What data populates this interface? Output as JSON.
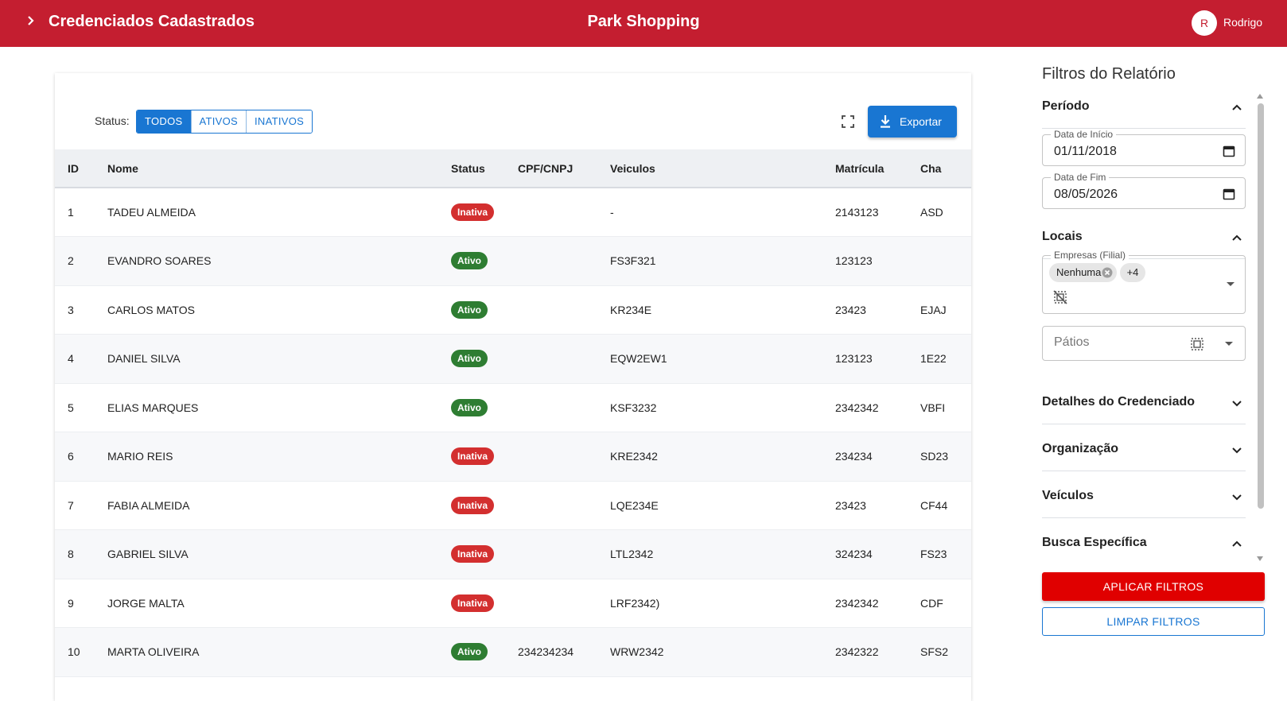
{
  "header": {
    "title": "Credenciados Cadastrados",
    "center_title": "Park Shopping",
    "avatar_initial": "R",
    "user_name": "Rodrigo"
  },
  "toolbar": {
    "status_label": "Status:",
    "toggles": [
      "TODOS",
      "ATIVOS",
      "INATIVOS"
    ],
    "selected_toggle": "TODOS",
    "export_label": "Exportar"
  },
  "table": {
    "columns": [
      "ID",
      "Nome",
      "Status",
      "CPF/CNPJ",
      "Veiculos",
      "Matrícula",
      "Cha"
    ],
    "rows": [
      {
        "id": "1",
        "nome": "TADEU ALMEIDA",
        "status": "Inativa",
        "cpf": "",
        "veiculos": "-",
        "matricula": "2143123",
        "chave": "ASD"
      },
      {
        "id": "2",
        "nome": "EVANDRO SOARES",
        "status": "Ativo",
        "cpf": "",
        "veiculos": "FS3F321",
        "matricula": "123123",
        "chave": ""
      },
      {
        "id": "3",
        "nome": "CARLOS MATOS",
        "status": "Ativo",
        "cpf": "",
        "veiculos": "KR234E",
        "matricula": "23423",
        "chave": "EJAJ"
      },
      {
        "id": "4",
        "nome": "DANIEL SILVA",
        "status": "Ativo",
        "cpf": "",
        "veiculos": "EQW2EW1",
        "matricula": "123123",
        "chave": "1E22"
      },
      {
        "id": "5",
        "nome": "ELIAS MARQUES",
        "status": "Ativo",
        "cpf": "",
        "veiculos": "KSF3232",
        "matricula": "2342342",
        "chave": "VBFI"
      },
      {
        "id": "6",
        "nome": "MARIO REIS",
        "status": "Inativa",
        "cpf": "",
        "veiculos": "KRE2342",
        "matricula": "234234",
        "chave": "SD23"
      },
      {
        "id": "7",
        "nome": "FABIA ALMEIDA",
        "status": "Inativa",
        "cpf": "",
        "veiculos": "LQE234E",
        "matricula": "23423",
        "chave": "CF44"
      },
      {
        "id": "8",
        "nome": "GABRIEL SILVA",
        "status": "Inativa",
        "cpf": "",
        "veiculos": "LTL2342",
        "matricula": "324234",
        "chave": "FS23"
      },
      {
        "id": "9",
        "nome": "JORGE MALTA",
        "status": "Inativa",
        "cpf": "",
        "veiculos": "LRF2342)",
        "matricula": "2342342",
        "chave": "CDF"
      },
      {
        "id": "10",
        "nome": "MARTA OLIVEIRA",
        "status": "Ativo",
        "cpf": "234234234",
        "veiculos": "WRW2342",
        "matricula": "2342322",
        "chave": "SFS2"
      }
    ]
  },
  "filters": {
    "title": "Filtros do Relatório",
    "periodo": {
      "label": "Período",
      "start_label": "Data de Início",
      "start_value": "01/11/2018",
      "end_label": "Data de Fim",
      "end_value": "08/05/2026"
    },
    "locais": {
      "label": "Locais",
      "empresas_label": "Empresas (Filial)",
      "chip": "Nenhuma",
      "more_chip": "+4",
      "patios_placeholder": "Pátios"
    },
    "sections": [
      "Detalhes do Credenciado",
      "Organização",
      "Veículos",
      "Busca Específica"
    ],
    "apply_label": "APLICAR FILTROS",
    "clear_label": "LIMPAR FILTROS"
  },
  "colors": {
    "brand": "#c41e30",
    "primary": "#1976d2",
    "apply": "#e00000",
    "inativa": "#d32f2f",
    "ativo": "#2e7d32"
  }
}
